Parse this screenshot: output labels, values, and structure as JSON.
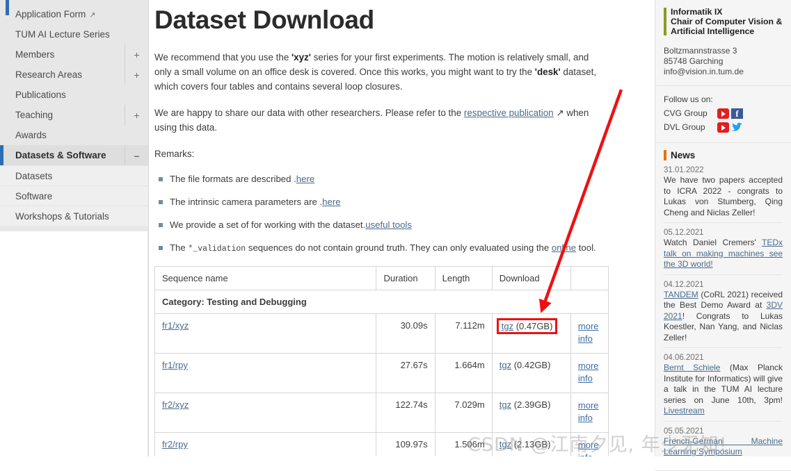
{
  "sidebar": {
    "items": [
      {
        "label": "Application Form",
        "external": true,
        "toggle": "",
        "active": false,
        "sub": false
      },
      {
        "label": "TUM AI Lecture Series",
        "external": false,
        "toggle": "",
        "active": false,
        "sub": false
      },
      {
        "label": "Members",
        "external": false,
        "toggle": "+",
        "active": false,
        "sub": false
      },
      {
        "label": "Research Areas",
        "external": false,
        "toggle": "+",
        "active": false,
        "sub": false
      },
      {
        "label": "Publications",
        "external": false,
        "toggle": "",
        "active": false,
        "sub": false
      },
      {
        "label": "Teaching",
        "external": false,
        "toggle": "+",
        "active": false,
        "sub": false
      },
      {
        "label": "Awards",
        "external": false,
        "toggle": "",
        "active": false,
        "sub": false
      },
      {
        "label": "Datasets & Software",
        "external": false,
        "toggle": "–",
        "active": true,
        "sub": false
      },
      {
        "label": "Datasets",
        "external": false,
        "toggle": "",
        "active": false,
        "sub": true
      },
      {
        "label": "Software",
        "external": false,
        "toggle": "",
        "active": false,
        "sub": true
      },
      {
        "label": "Workshops & Tutorials",
        "external": false,
        "toggle": "",
        "active": false,
        "sub": true
      }
    ]
  },
  "main": {
    "title": "Dataset Download",
    "para1": {
      "t1": "We recommend that you use the ",
      "b1": "'xyz'",
      "t2": " series for your first experiments. The motion is relatively small, and only a small volume on an office desk is covered. Once this works, you might want to try the ",
      "b2": "'desk'",
      "t3": " dataset, which covers four tables and contains several loop closures."
    },
    "para2": {
      "t1": "We are happy to share our data with other researchers. Please refer to the ",
      "link": "respective publication",
      "t2": " when using this data."
    },
    "remarks_label": "Remarks:",
    "remarks": [
      {
        "t1": "The file formats are described ",
        "link": "here",
        "t2": "."
      },
      {
        "t1": "The intrinsic camera parameters are ",
        "link": "here",
        "t2": "."
      },
      {
        "t1": "We provide a set of ",
        "link": "useful tools",
        "t2": " for working with the dataset."
      },
      {
        "t1": "The ",
        "code": "*_validation",
        "t2": " sequences do not contain ground truth. They can only evaluated using the ",
        "link2": "online",
        "t3": " tool."
      }
    ],
    "table": {
      "headers": [
        "Sequence name",
        "Duration",
        "Length",
        "Download",
        ""
      ],
      "category_row": "Category: Testing and Debugging",
      "info_label_line1": "more",
      "info_label_line2": "info",
      "rows": [
        {
          "name": "fr1/xyz",
          "duration": "30.09s",
          "length": "7.112m",
          "download_link": "tgz",
          "download_size": "(0.47GB)",
          "highlighted": true
        },
        {
          "name": "fr1/rpy",
          "duration": "27.67s",
          "length": "1.664m",
          "download_link": "tgz",
          "download_size": "(0.42GB)",
          "highlighted": false
        },
        {
          "name": "fr2/xyz",
          "duration": "122.74s",
          "length": "7.029m",
          "download_link": "tgz",
          "download_size": "(2.39GB)",
          "highlighted": false
        },
        {
          "name": "fr2/rpy",
          "duration": "109.97s",
          "length": "1.506m",
          "download_link": "tgz",
          "download_size": "(2.13GB)",
          "highlighted": false
        }
      ]
    }
  },
  "rightbar": {
    "institute": {
      "line1": "Informatik IX",
      "line2": "Chair of Computer Vision &",
      "line3": "Artificial Intelligence",
      "address1": "Boltzmannstrasse 3",
      "address2": "85748 Garching",
      "email": "info@vision.in.tum.de"
    },
    "follow": {
      "heading": "Follow us on:",
      "groups": [
        {
          "name": "CVG Group",
          "icons": [
            "youtube-icon",
            "facebook-icon"
          ]
        },
        {
          "name": "DVL Group",
          "icons": [
            "youtube-icon",
            "twitter-icon"
          ]
        }
      ]
    },
    "news_heading": "News",
    "news": [
      {
        "date": "31.01.2022",
        "text": "We have two papers accepted to ICRA 2022 - congrats to Lukas von Stumberg, Qing Cheng and Niclas Zeller!"
      },
      {
        "date": "05.12.2021",
        "pre": "Watch Daniel Cremers' ",
        "link": "TEDx talk on making machines see the 3D world!",
        "post": ""
      },
      {
        "date": "04.12.2021",
        "pre": "",
        "link": "TANDEM",
        "post": " (CoRL 2021) received the Best Demo Award at ",
        "link2": "3DV 2021",
        "post2": "! Congrats to Lukas Koestler, Nan Yang, and Niclas Zeller!"
      },
      {
        "date": "04.06.2021",
        "pre": "",
        "link": "Bernt Schiele",
        "post": " (Max Planck Institute for Informatics) will give a talk in the TUM AI lecture series on June 10th, 3pm! ",
        "link2": "Livestream",
        "post2": ""
      },
      {
        "date": "05.05.2021",
        "pre": "",
        "link": "French-German Machine Learning Symposium",
        "post": ""
      }
    ]
  },
  "annotations": {
    "watermark": "CSDN @江南夕见, 年少无知!",
    "arrow_color": "#ee1111",
    "highlight_color": "#ee1111"
  }
}
